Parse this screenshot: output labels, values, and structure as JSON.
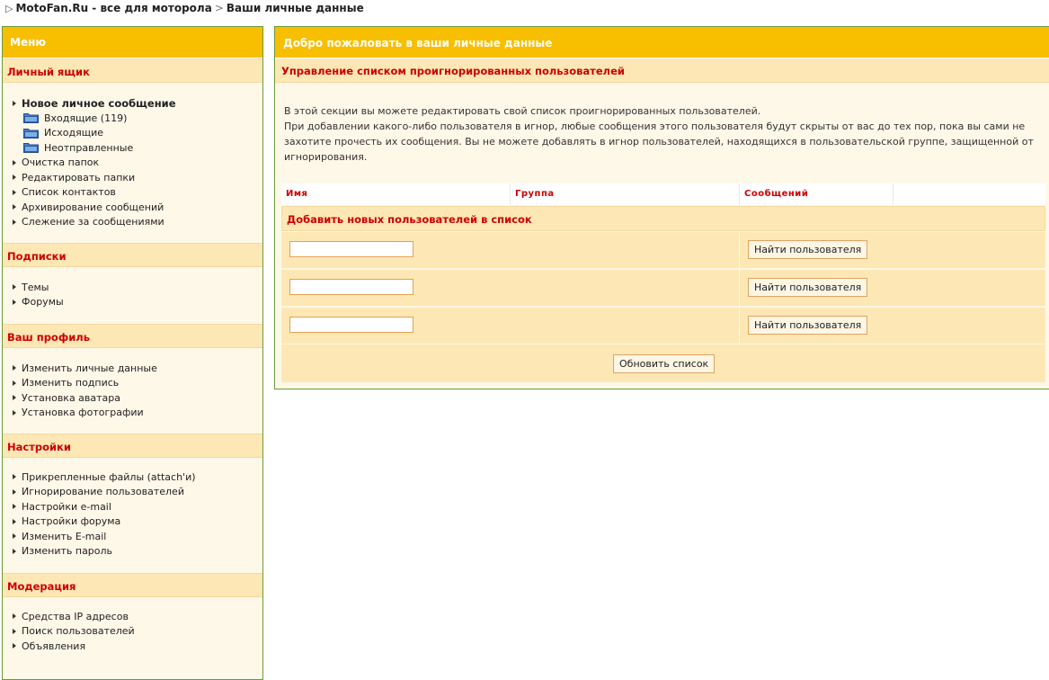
{
  "breadcrumb": {
    "site": "MotoFan.Ru - все для моторола",
    "separator": ">",
    "current": "Ваши личные данные"
  },
  "sidebar": {
    "title": "Меню",
    "sections": [
      {
        "title": "Личный ящик",
        "items": [
          {
            "label": "Новое личное сообщение"
          },
          {
            "label": "Входящие (119)"
          },
          {
            "label": "Исходящие"
          },
          {
            "label": "Неотправленные"
          },
          {
            "label": "Очистка папок"
          },
          {
            "label": "Редактировать папки"
          },
          {
            "label": "Список контактов"
          },
          {
            "label": "Архивирование сообщений"
          },
          {
            "label": "Слежение за сообщениями"
          }
        ]
      },
      {
        "title": "Подписки",
        "items": [
          {
            "label": "Темы"
          },
          {
            "label": "Форумы"
          }
        ]
      },
      {
        "title": "Ваш профиль",
        "items": [
          {
            "label": "Изменить личные данные"
          },
          {
            "label": "Изменить подпись"
          },
          {
            "label": "Установка аватара"
          },
          {
            "label": "Установка фотографии"
          }
        ]
      },
      {
        "title": "Настройки",
        "items": [
          {
            "label": "Прикрепленные файлы (attach'и)"
          },
          {
            "label": "Игнорирование пользователей"
          },
          {
            "label": "Настройки e-mail"
          },
          {
            "label": "Настройки форума"
          },
          {
            "label": "Изменить E-mail"
          },
          {
            "label": "Изменить пароль"
          }
        ]
      },
      {
        "title": "Модерация",
        "items": [
          {
            "label": "Средства IP адресов"
          },
          {
            "label": "Поиск пользователей"
          },
          {
            "label": "Объявления"
          }
        ]
      }
    ]
  },
  "main": {
    "title": "Добро пожаловать в ваши личные данные",
    "subtitle": "Управление списком проигнорированных пользователей",
    "intro_line1": "В этой секции вы можете редактировать свой список проигнорированных пользователей.",
    "intro_line2": "При добавлении какого-либо пользователя в игнор, любые сообщения этого пользователя будут скрыты от вас до тех пор, пока вы сами не захотите прочесть их сообщения. Вы не можете добавлять в игнор пользователей, находящихся в пользовательской группе, защищенной от игнорирования.",
    "columns": [
      "Имя",
      "Группа",
      "Сообщений"
    ],
    "add_title": "Добавить новых пользователей в список",
    "rows": [
      {
        "value": "",
        "button": "Найти пользователя"
      },
      {
        "value": "",
        "button": "Найти пользователя"
      },
      {
        "value": "",
        "button": "Найти пользователя"
      }
    ],
    "update_button": "Обновить список"
  },
  "colors": {
    "header_bg": "#f8be00",
    "section_bg": "#fde8b5",
    "panel_bg": "#fef8e9",
    "accent_red": "#cc0000",
    "border_green": "#6a9a3a"
  }
}
